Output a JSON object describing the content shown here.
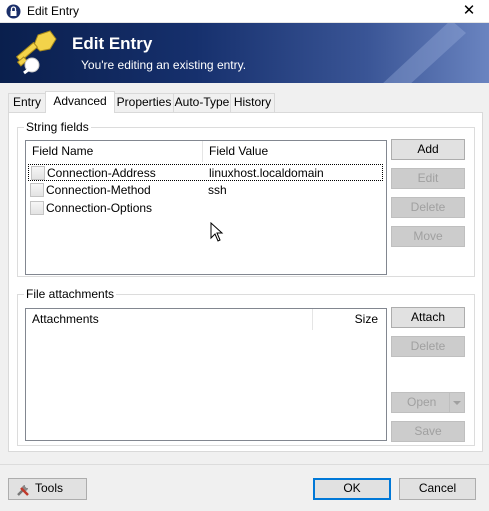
{
  "window": {
    "title": "Edit Entry",
    "close_glyph": "✕"
  },
  "banner": {
    "title": "Edit Entry",
    "subtitle": "You're editing an existing entry."
  },
  "tabs": [
    {
      "label": "Entry",
      "active": false
    },
    {
      "label": "Advanced",
      "active": true
    },
    {
      "label": "Properties",
      "active": false
    },
    {
      "label": "Auto-Type",
      "active": false
    },
    {
      "label": "History",
      "active": false
    }
  ],
  "string_fields": {
    "group_label": "String fields",
    "columns": {
      "name": "Field Name",
      "value": "Field Value"
    },
    "rows": [
      {
        "name": "Connection-Address",
        "value": "linuxhost.localdomain"
      },
      {
        "name": "Connection-Method",
        "value": "ssh"
      },
      {
        "name": "Connection-Options",
        "value": ""
      }
    ],
    "buttons": {
      "add": "Add",
      "edit": "Edit",
      "delete": "Delete",
      "move": "Move"
    }
  },
  "file_attachments": {
    "group_label": "File attachments",
    "columns": {
      "name": "Attachments",
      "size": "Size"
    },
    "buttons": {
      "attach": "Attach",
      "delete": "Delete",
      "open": "Open",
      "save": "Save"
    }
  },
  "footer": {
    "tools": "Tools",
    "ok": "OK",
    "cancel": "Cancel"
  },
  "colors": {
    "banner_dark": "#0a1f4d",
    "banner_light": "#6a84c0",
    "default_button_border": "#0078d7"
  },
  "icons": [
    "lock-app-icon",
    "close-icon",
    "key-icon",
    "tools-icon",
    "mouse-cursor-icon"
  ]
}
